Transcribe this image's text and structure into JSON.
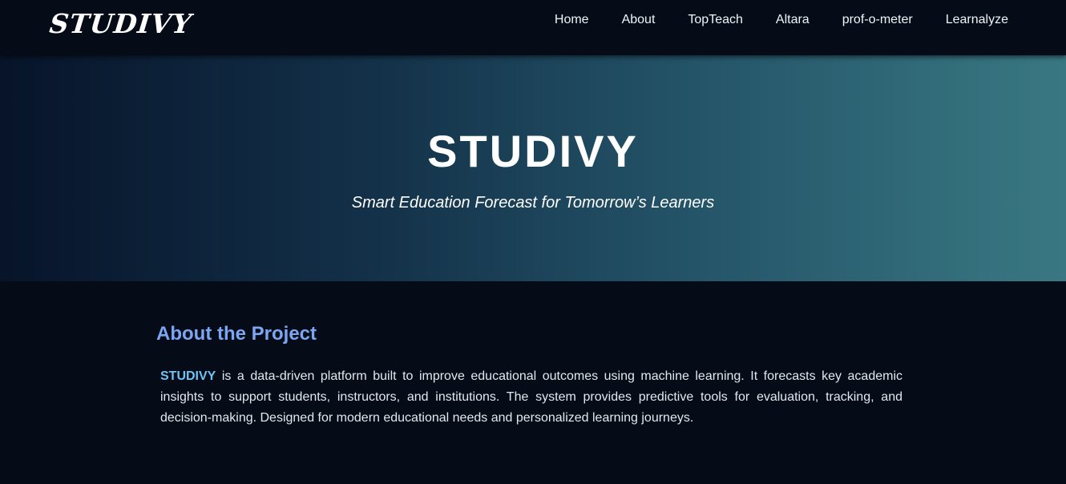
{
  "navbar": {
    "logo": "STUDIVY",
    "links": [
      "Home",
      "About",
      "TopTeach",
      "Altara",
      "prof-o-meter",
      "Learnalyze"
    ]
  },
  "hero": {
    "title": "STUDIVY",
    "subtitle": "Smart Education Forecast for Tomorrow’s Learners"
  },
  "about": {
    "heading": "About the Project",
    "brand": "STUDIVY",
    "text": " is a data-driven platform built to improve educational outcomes using machine learning. It forecasts key academic insights to support students, instructors, and institutions. The system provides predictive tools for evaluation, tracking, and decision-making. Designed for modern educational needs and personalized learning journeys."
  },
  "colors": {
    "background": "#050b17",
    "hero_gradient_start": "#07142a",
    "hero_gradient_end": "#397883",
    "heading_accent": "#7aa6f2",
    "brand_highlight": "#6fc3f5"
  }
}
